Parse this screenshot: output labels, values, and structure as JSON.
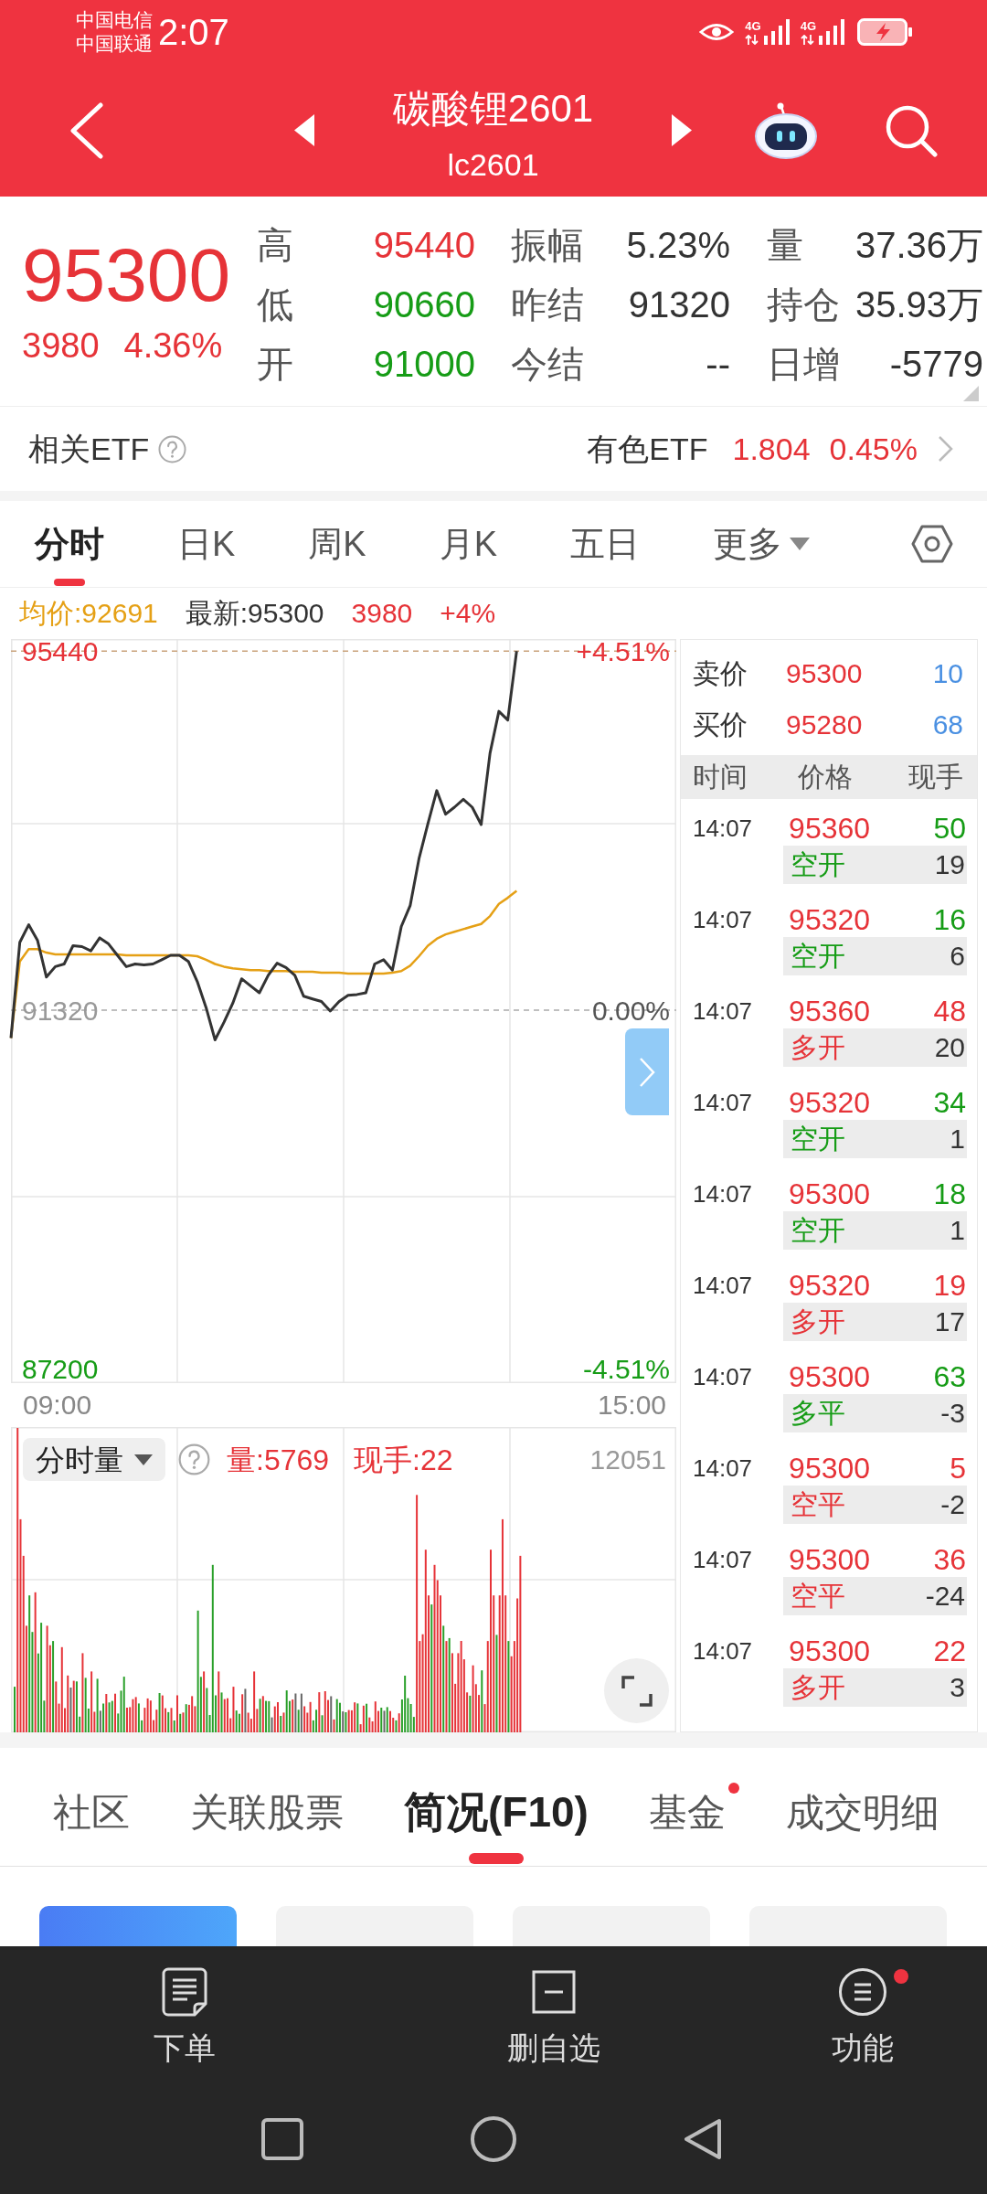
{
  "status_bar": {
    "carriers": [
      "中国电信",
      "中国联通"
    ],
    "time": "2:07",
    "networks": [
      "4G",
      "4G"
    ]
  },
  "header": {
    "title": "碳酸锂2601",
    "code": "lc2601"
  },
  "quote": {
    "price": "95300",
    "change": "3980",
    "change_percent": "4.36%",
    "rising": true,
    "stats": [
      [
        {
          "label": "高",
          "value": "95440",
          "color": "#e63338"
        },
        {
          "label": "振幅",
          "value": "5.23%",
          "color": "#333333"
        },
        {
          "label": "量",
          "value": "37.36万",
          "color": "#333333"
        }
      ],
      [
        {
          "label": "低",
          "value": "90660",
          "color": "#169c16"
        },
        {
          "label": "昨结",
          "value": "91320",
          "color": "#333333"
        },
        {
          "label": "持仓",
          "value": "35.93万",
          "color": "#333333"
        }
      ],
      [
        {
          "label": "开",
          "value": "91000",
          "color": "#169c16"
        },
        {
          "label": "今结",
          "value": "--",
          "color": "#333333"
        },
        {
          "label": "日增",
          "value": "-5779",
          "color": "#333333"
        }
      ]
    ]
  },
  "related_etf": {
    "label": "相关ETF",
    "name": "有色ETF",
    "price": "1.804",
    "change_percent": "0.45%",
    "rising": true
  },
  "period_tabs": [
    {
      "label": "分时",
      "selected": true,
      "kind": "tab"
    },
    {
      "label": "日K",
      "selected": false,
      "kind": "tab"
    },
    {
      "label": "周K",
      "selected": false,
      "kind": "tab"
    },
    {
      "label": "月K",
      "selected": false,
      "kind": "tab"
    },
    {
      "label": "五日",
      "selected": false,
      "kind": "tab"
    },
    {
      "label": "更多",
      "selected": false,
      "kind": "dropdown"
    }
  ],
  "price_chart": {
    "legend_extras": [
      {
        "text": "3980",
        "color": "#e63338"
      },
      {
        "text": "+4%",
        "color": "#e63338"
      }
    ],
    "percent_labels": [
      "+4.51%",
      "0.00%",
      "-4.51%"
    ],
    "time_axis_labels": [
      "09:00",
      "15:00"
    ],
    "chart_data": {
      "type": "line",
      "categories": [
        null,
        null,
        null,
        null,
        null,
        null,
        null,
        null,
        null,
        null,
        null,
        null,
        null,
        null,
        null,
        null,
        null,
        null,
        null,
        null,
        null,
        null,
        null,
        null,
        null,
        null,
        null,
        null,
        null,
        null,
        null,
        null,
        null,
        null,
        null,
        null,
        null,
        null,
        null,
        null,
        null,
        null,
        null,
        null,
        null,
        null,
        null,
        null,
        null,
        null,
        null,
        null,
        null,
        null,
        null,
        null,
        null,
        null,
        null,
        null,
        null,
        null,
        null,
        null,
        null,
        null,
        null,
        null,
        null,
        null,
        null,
        null,
        null,
        null,
        null,
        null
      ],
      "series": [
        {
          "name": "均价:92691",
          "color": "#e5a015",
          "values": [
            91000,
            91880,
            92020,
            92020,
            91980,
            91960,
            91960,
            91960,
            91960,
            91960,
            91960,
            91960,
            91960,
            91950,
            91950,
            91950,
            91950,
            91950,
            91950,
            91950,
            91950,
            91940,
            91900,
            91850,
            91820,
            91800,
            91790,
            91780,
            91780,
            91770,
            91770,
            91770,
            91760,
            91760,
            91760,
            91750,
            91750,
            91750,
            91740,
            91740,
            91740,
            91740,
            91740,
            91750,
            91770,
            91830,
            91940,
            92060,
            92140,
            92190,
            92220,
            92250,
            92280,
            92310,
            92400,
            92540,
            92610,
            92690,
            null,
            null,
            null,
            null,
            null,
            null,
            null,
            null,
            null,
            null,
            null,
            null,
            null,
            null,
            null,
            null,
            null,
            null
          ]
        },
        {
          "name": "最新:95300",
          "color": "#333333",
          "values": [
            91000,
            92100,
            92300,
            92120,
            91700,
            91820,
            91850,
            92060,
            92050,
            92000,
            92150,
            92080,
            91950,
            91820,
            91850,
            91840,
            91850,
            91900,
            91950,
            91950,
            91880,
            91650,
            91350,
            90980,
            91180,
            91400,
            91680,
            91600,
            91520,
            91720,
            91860,
            91810,
            91720,
            91480,
            91450,
            91420,
            91310,
            91420,
            91490,
            91500,
            91520,
            91850,
            91900,
            91780,
            92280,
            92520,
            93060,
            93460,
            93840,
            93570,
            93650,
            93740,
            93650,
            93450,
            94270,
            94750,
            94650,
            95440,
            null,
            null,
            null,
            null,
            null,
            null,
            null,
            null,
            null,
            null,
            null,
            null,
            null,
            null,
            null,
            null,
            null,
            null
          ]
        }
      ],
      "ylim": [
        87040,
        95580
      ],
      "yticks": [
        {
          "value": 87200,
          "label": "87200"
        },
        {
          "value": 91320,
          "label": "91320"
        },
        {
          "value": 95440,
          "label": "95440"
        }
      ],
      "ref_lines": [
        {
          "axis": "y",
          "value": 95440,
          "color": "#c9a27a"
        },
        {
          "axis": "y",
          "value": 91320,
          "color": "#aaaaaa"
        }
      ]
    }
  },
  "volume_chart": {
    "selector": "分时量",
    "volume": "量:5769",
    "last_volume": "现手:22",
    "max_label": "12051"
  },
  "order_book": {
    "quotes": [
      {
        "label": "卖价",
        "price": "95300",
        "volume": "10"
      },
      {
        "label": "买价",
        "price": "95280",
        "volume": "68"
      }
    ],
    "columns": [
      "时间",
      "价格",
      "现手"
    ],
    "trades": [
      {
        "time": "14:07",
        "price": "95360",
        "volume": "50",
        "type": "空开",
        "change": "19",
        "color": "#169c16"
      },
      {
        "time": "14:07",
        "price": "95320",
        "volume": "16",
        "type": "空开",
        "change": "6",
        "color": "#169c16"
      },
      {
        "time": "14:07",
        "price": "95360",
        "volume": "48",
        "type": "多开",
        "change": "20",
        "color": "#e63338"
      },
      {
        "time": "14:07",
        "price": "95320",
        "volume": "34",
        "type": "空开",
        "change": "1",
        "color": "#169c16"
      },
      {
        "time": "14:07",
        "price": "95300",
        "volume": "18",
        "type": "空开",
        "change": "1",
        "color": "#169c16"
      },
      {
        "time": "14:07",
        "price": "95320",
        "volume": "19",
        "type": "多开",
        "change": "17",
        "color": "#e63338"
      },
      {
        "time": "14:07",
        "price": "95300",
        "volume": "63",
        "type": "多平",
        "change": "-3",
        "color": "#169c16"
      },
      {
        "time": "14:07",
        "price": "95300",
        "volume": "5",
        "type": "空平",
        "change": "-2",
        "color": "#e63338"
      },
      {
        "time": "14:07",
        "price": "95300",
        "volume": "36",
        "type": "空平",
        "change": "-24",
        "color": "#e63338"
      },
      {
        "time": "14:07",
        "price": "95300",
        "volume": "22",
        "type": "多开",
        "change": "3",
        "color": "#e63338"
      }
    ]
  },
  "info_tabs": [
    {
      "label": "社区",
      "selected": false,
      "dot": false
    },
    {
      "label": "关联股票",
      "selected": false,
      "dot": false
    },
    {
      "label": "简况(F10)",
      "selected": true,
      "dot": false
    },
    {
      "label": "基金",
      "selected": false,
      "dot": true
    },
    {
      "label": "成交明细",
      "selected": false,
      "dot": false
    }
  ],
  "sub_tabs": [
    {
      "selected": true
    },
    {
      "selected": false
    },
    {
      "selected": false
    },
    {
      "selected": false
    }
  ],
  "bottom_actions": [
    {
      "label": "下单",
      "kind": "order",
      "dot": false
    },
    {
      "label": "删自选",
      "kind": "remove",
      "dot": false
    },
    {
      "label": "功能",
      "kind": "functions",
      "dot": true
    }
  ]
}
